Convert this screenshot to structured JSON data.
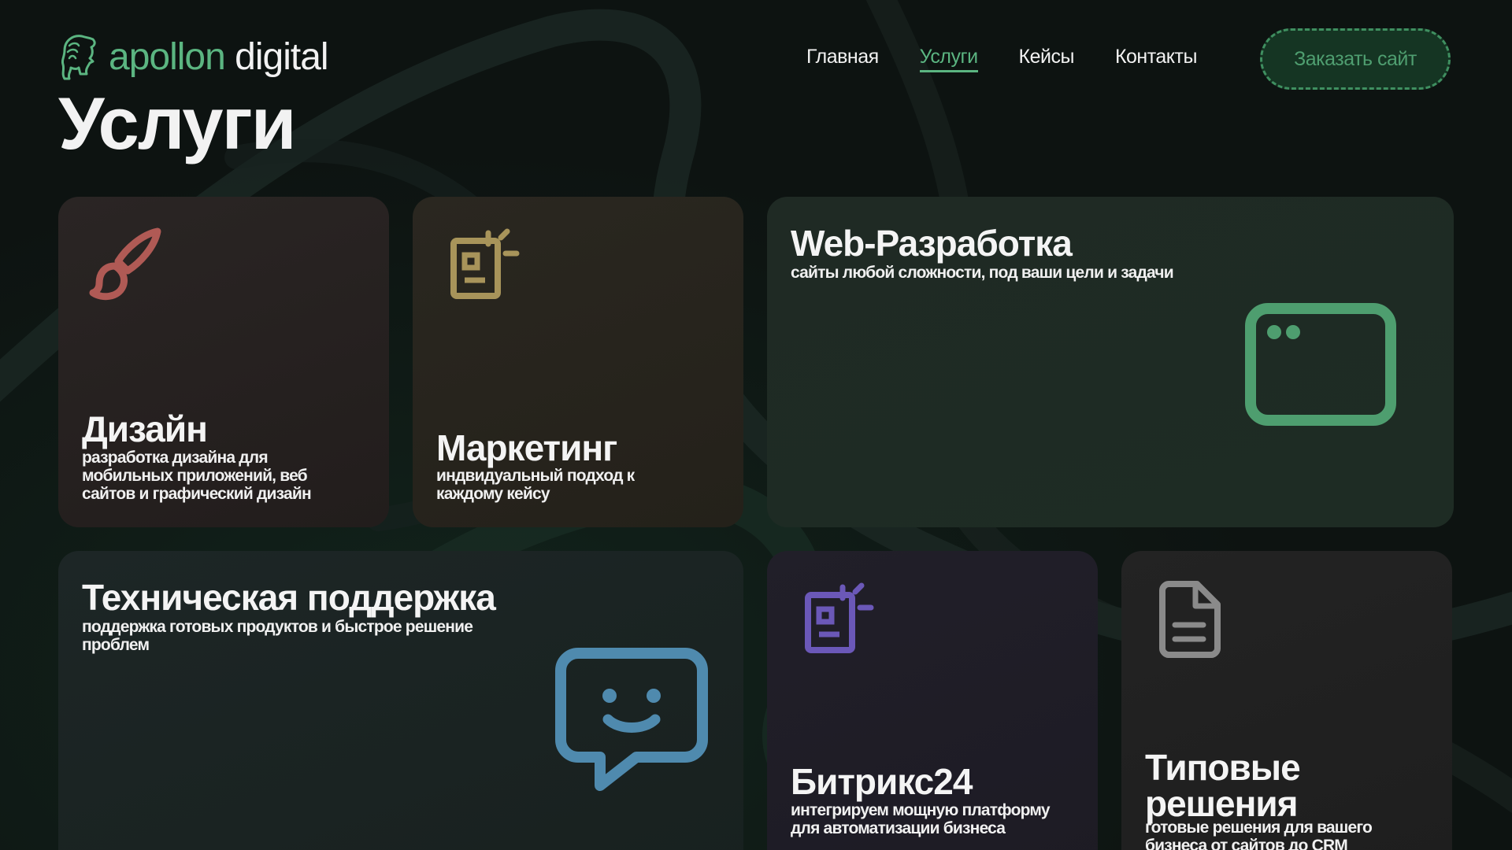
{
  "header": {
    "logo_word1": "apollon",
    "logo_word2": "digital",
    "nav": [
      {
        "label": "Главная"
      },
      {
        "label": "Услуги"
      },
      {
        "label": "Кейсы"
      },
      {
        "label": "Контакты"
      }
    ],
    "cta_label": "Заказать сайт"
  },
  "page_title": "Услуги",
  "services": {
    "design": {
      "title": "Дизайн",
      "description": "разработка дизайна для мобильных приложений, веб сайтов и графический дизайн",
      "icon": "brush-icon",
      "color": "#b05a55"
    },
    "marketing": {
      "title": "Маркетинг",
      "description": "индвидуальный подход к каждому кейсу",
      "icon": "news-icon",
      "color": "#a8945a"
    },
    "web": {
      "title": "Web-Разработка",
      "description": "сайты любой сложности, под ваши цели и задачи",
      "icon": "browser-window-icon",
      "color": "#4e9e6f"
    },
    "support": {
      "title": "Техническая поддержка",
      "description": "поддержка готовых продуктов и быстрое решение проблем",
      "icon": "chat-smile-icon",
      "color": "#4f8aae"
    },
    "bitrix": {
      "title": "Битрикс24",
      "description": "интегрируем мощную платформу для автоматизации бизнеса",
      "icon": "news-icon",
      "color": "#6b58b8"
    },
    "typical": {
      "title": "Типовые решения",
      "description": "готовые решения для вашего бизнеса от сайтов до CRM",
      "icon": "document-icon",
      "color": "#8a8a8a"
    }
  },
  "colors": {
    "accent": "#5bb581",
    "background": "#0d1311"
  }
}
